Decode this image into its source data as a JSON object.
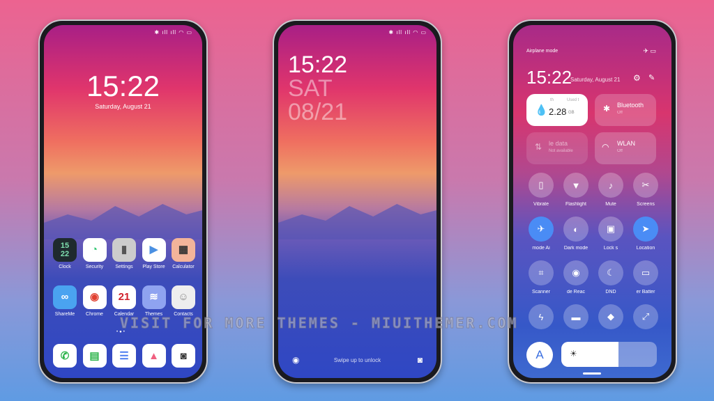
{
  "home": {
    "time": "15:22",
    "date": "Saturday, August 21",
    "status": "✱ ıll ıll ◠ ▭",
    "apps": [
      {
        "label": "Clock",
        "glyph": "15\n22",
        "bg": "#1f2a2e",
        "fg": "#7fe0b0"
      },
      {
        "label": "Security",
        "glyph": "◔",
        "bg": "#fff",
        "fg": "#2cc56f"
      },
      {
        "label": "Settings",
        "glyph": "▮",
        "bg": "#ccc",
        "fg": "#555"
      },
      {
        "label": "Play Store",
        "glyph": "▶",
        "bg": "#fff",
        "fg": "#4a90e2"
      },
      {
        "label": "Calculator",
        "glyph": "▦",
        "bg": "#f3b49a",
        "fg": "#333"
      },
      {
        "label": "ShareMe",
        "glyph": "∞",
        "bg": "#4aa3f0",
        "fg": "#fff"
      },
      {
        "label": "Chrome",
        "glyph": "◉",
        "bg": "#fff",
        "fg": "#e04030"
      },
      {
        "label": "Calendar",
        "glyph": "21",
        "bg": "#fff",
        "fg": "#d0202a"
      },
      {
        "label": "Themes",
        "glyph": "≋",
        "bg": "#8fa3f0",
        "fg": "#fff"
      },
      {
        "label": "Contacts",
        "glyph": "☺",
        "bg": "#eee",
        "fg": "#888"
      }
    ],
    "dock": [
      {
        "name": "phone",
        "glyph": "✆",
        "fg": "#2cb34a"
      },
      {
        "name": "messages",
        "glyph": "▤",
        "fg": "#2cb34a"
      },
      {
        "name": "notes",
        "glyph": "☰",
        "fg": "#4a7cf0"
      },
      {
        "name": "gallery",
        "glyph": "▲",
        "fg": "#f06080"
      },
      {
        "name": "camera",
        "glyph": "◙",
        "fg": "#333"
      }
    ]
  },
  "lock": {
    "time": "15:22",
    "day": "SAT",
    "date": "08/21",
    "hint": "Swipe up to unlock",
    "status": "✱ ıll ıll ◠ ▭"
  },
  "control": {
    "mode_label": "Airplane mode",
    "status": "✈ ▭",
    "time": "15:22",
    "date": "Saturday, August 21",
    "data_tile": {
      "left": "th",
      "right": "Used t",
      "value": "2.28",
      "unit": "GB"
    },
    "bluetooth": {
      "label": "Bluetooth",
      "state": "Off"
    },
    "mobile": {
      "label": "le data",
      "state": "Not available"
    },
    "wlan": {
      "label": "WLAN",
      "state": "Off"
    },
    "toggles": [
      {
        "label": "Vibrate",
        "glyph": "▯",
        "on": false
      },
      {
        "label": "Flashlight",
        "glyph": "▼",
        "on": false
      },
      {
        "label": "Mute",
        "glyph": "♪",
        "on": false
      },
      {
        "label": "Screens",
        "glyph": "✂",
        "on": false
      },
      {
        "label": "mode   Ai",
        "glyph": "✈",
        "on": true
      },
      {
        "label": "Dark mode",
        "glyph": "◐",
        "on": false
      },
      {
        "label": "Lock s",
        "glyph": "▣",
        "on": false
      },
      {
        "label": "Location",
        "glyph": "➤",
        "on": true
      },
      {
        "label": "Scanner",
        "glyph": "⌗",
        "on": false
      },
      {
        "label": "de  Reac",
        "glyph": "◉",
        "on": false
      },
      {
        "label": "DND",
        "glyph": "☾",
        "on": false
      },
      {
        "label": "er  Batter",
        "glyph": "▭",
        "on": false
      },
      {
        "label": "",
        "glyph": "ϟ",
        "on": false
      },
      {
        "label": "",
        "glyph": "▬",
        "on": false
      },
      {
        "label": "",
        "glyph": "◆",
        "on": false
      },
      {
        "label": "",
        "glyph": "⤢",
        "on": false
      }
    ],
    "font_button": "A",
    "brightness_icon": "☀",
    "brightness_level": 0.6
  },
  "watermark": "VISIT FOR MORE THEMES - MIUITHEMER.COM"
}
